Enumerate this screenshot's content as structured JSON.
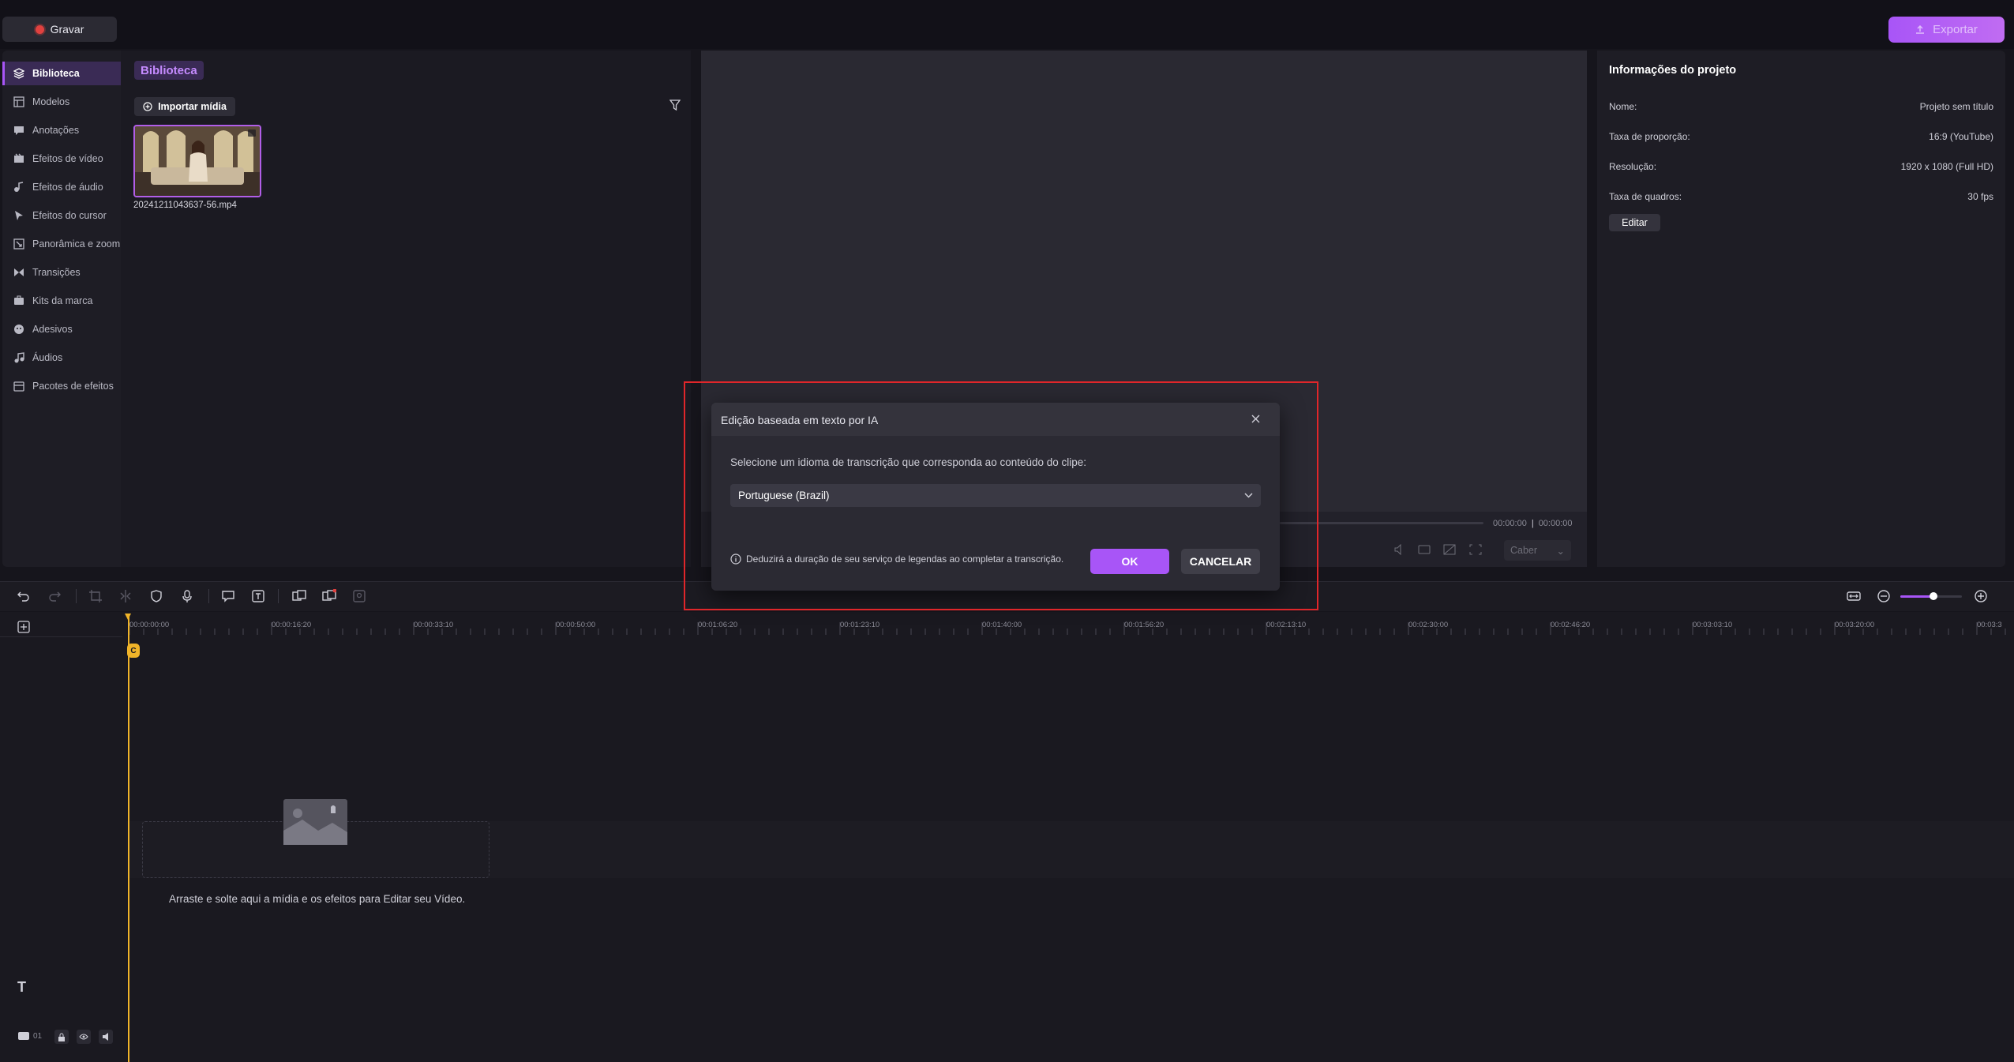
{
  "topbar": {
    "record_label": "Gravar",
    "export_label": "Exportar"
  },
  "sidebar": {
    "items": [
      {
        "label": "Biblioteca",
        "icon": "layers-icon"
      },
      {
        "label": "Modelos",
        "icon": "template-icon"
      },
      {
        "label": "Anotações",
        "icon": "annotation-icon"
      },
      {
        "label": "Efeitos de vídeo",
        "icon": "video-effects-icon"
      },
      {
        "label": "Efeitos de áudio",
        "icon": "audio-effects-icon"
      },
      {
        "label": "Efeitos do cursor",
        "icon": "cursor-icon"
      },
      {
        "label": "Panorâmica e zoom",
        "icon": "zoom-icon"
      },
      {
        "label": "Transições",
        "icon": "transition-icon"
      },
      {
        "label": "Kits da marca",
        "icon": "brand-kit-icon"
      },
      {
        "label": "Adesivos",
        "icon": "sticker-icon"
      },
      {
        "label": "Áudios",
        "icon": "music-icon"
      },
      {
        "label": "Pacotes de efeitos",
        "icon": "effects-pack-icon"
      }
    ]
  },
  "library": {
    "tab_label": "Biblioteca",
    "import_label": "Importar mídia",
    "media": [
      {
        "name": "20241211043637-56.mp4"
      }
    ]
  },
  "preview": {
    "time_current": "00:00:00",
    "time_total": "00:00:00",
    "fit_label": "Caber"
  },
  "project": {
    "title": "Informações do projeto",
    "rows": [
      {
        "label": "Nome:",
        "value": "Projeto sem título"
      },
      {
        "label": "Taxa de proporção:",
        "value": "16:9 (YouTube)"
      },
      {
        "label": "Resolução:",
        "value": "1920 x 1080 (Full HD)"
      },
      {
        "label": "Taxa de quadros:",
        "value": "30 fps"
      }
    ],
    "edit_label": "Editar"
  },
  "timeline": {
    "ticks": [
      "00:00:00:00",
      "00:00:16:20",
      "00:00:33:10",
      "00:00:50:00",
      "00:01:06:20",
      "00:01:23:10",
      "00:01:40:00",
      "00:01:56:20",
      "00:02:13:10",
      "00:02:30:00",
      "00:02:46:20",
      "00:03:03:10",
      "00:03:20:00",
      "00:03:3"
    ],
    "drop_text": "Arraste e solte aqui a mídia e os efeitos para Editar seu Vídeo.",
    "track_count": "01"
  },
  "dialog": {
    "title": "Edição baseada em texto por IA",
    "prompt": "Selecione um idioma de transcrição que corresponda ao conteúdo do clipe:",
    "language": "Portuguese (Brazil)",
    "note": "Deduzirá a duração de seu serviço de legendas ao completar a transcrição.",
    "ok_label": "OK",
    "cancel_label": "CANCELAR"
  },
  "colors": {
    "accent": "#a855f7",
    "highlight": "#e0262a",
    "playhead": "#f0b429"
  }
}
